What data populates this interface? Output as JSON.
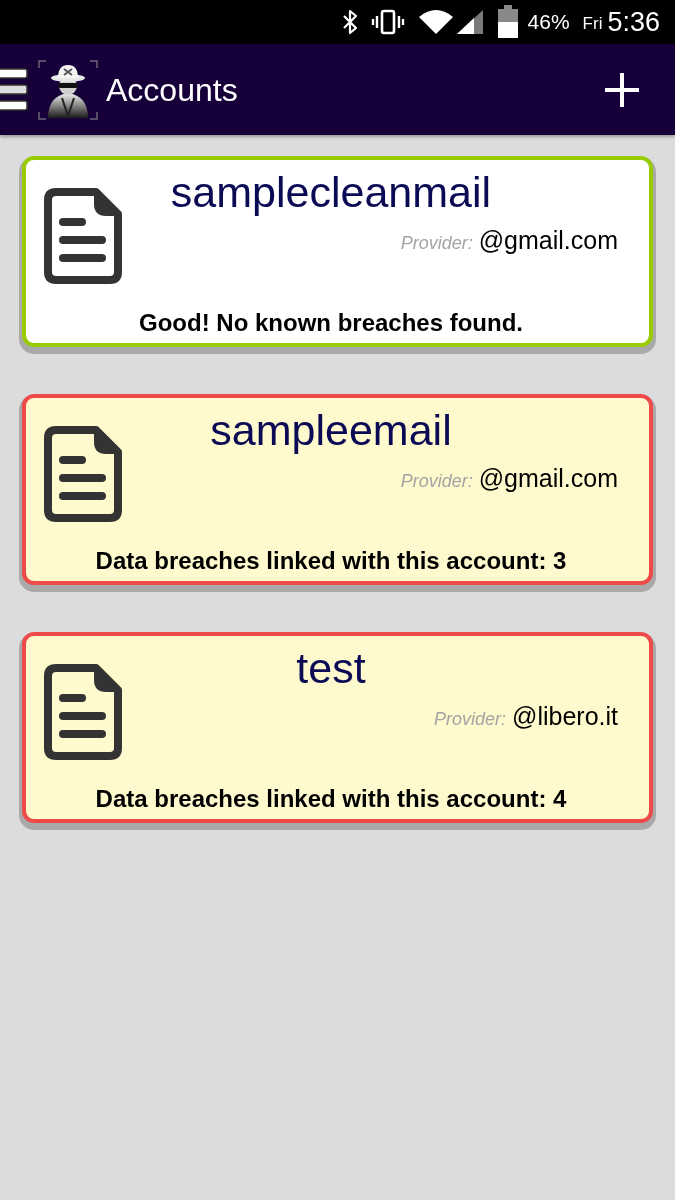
{
  "status_bar": {
    "battery": "46%",
    "day": "Fri",
    "time": "5:36"
  },
  "app_bar": {
    "title": "Accounts"
  },
  "accounts": [
    {
      "kind": "clean",
      "name": "samplecleanmail",
      "provider_label": "Provider:",
      "provider": "@gmail.com",
      "message": "Good! No known breaches found."
    },
    {
      "kind": "breached",
      "name": "sampleemail",
      "provider_label": "Provider:",
      "provider": "@gmail.com",
      "message": "Data breaches linked with this account: 3"
    },
    {
      "kind": "breached",
      "name": "test",
      "provider_label": "Provider:",
      "provider": "@libero.it",
      "message": "Data breaches linked with this account: 4"
    }
  ]
}
